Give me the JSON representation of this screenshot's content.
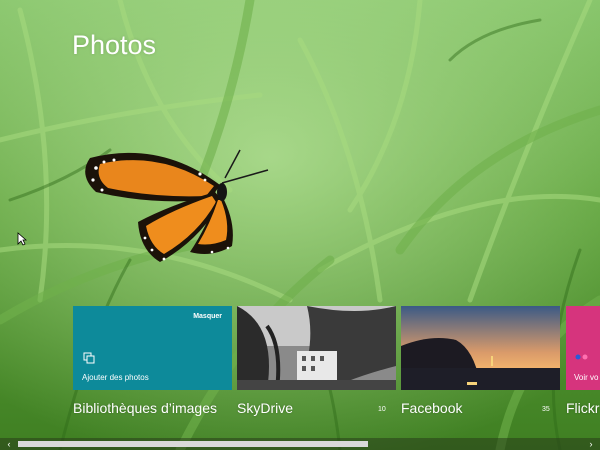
{
  "app": {
    "title": "Photos"
  },
  "tiles": [
    {
      "caption": "Bibliothèques d’images",
      "action_label": "Ajouter des photos",
      "hide_label": "Masquer",
      "icon": "add-photos-icon"
    },
    {
      "caption": "SkyDrive",
      "count": "10"
    },
    {
      "caption": "Facebook",
      "count": "35"
    },
    {
      "caption": "Flickr",
      "action_label": "Voir vo",
      "icon": "flickr-dots-icon"
    }
  ],
  "scrollbar": {
    "left_icon": "‹",
    "right_icon": "›"
  },
  "colors": {
    "tile_teal": "#0d8a9a",
    "tile_pink": "#d6347d",
    "accent_green": "#3d7a1c"
  }
}
